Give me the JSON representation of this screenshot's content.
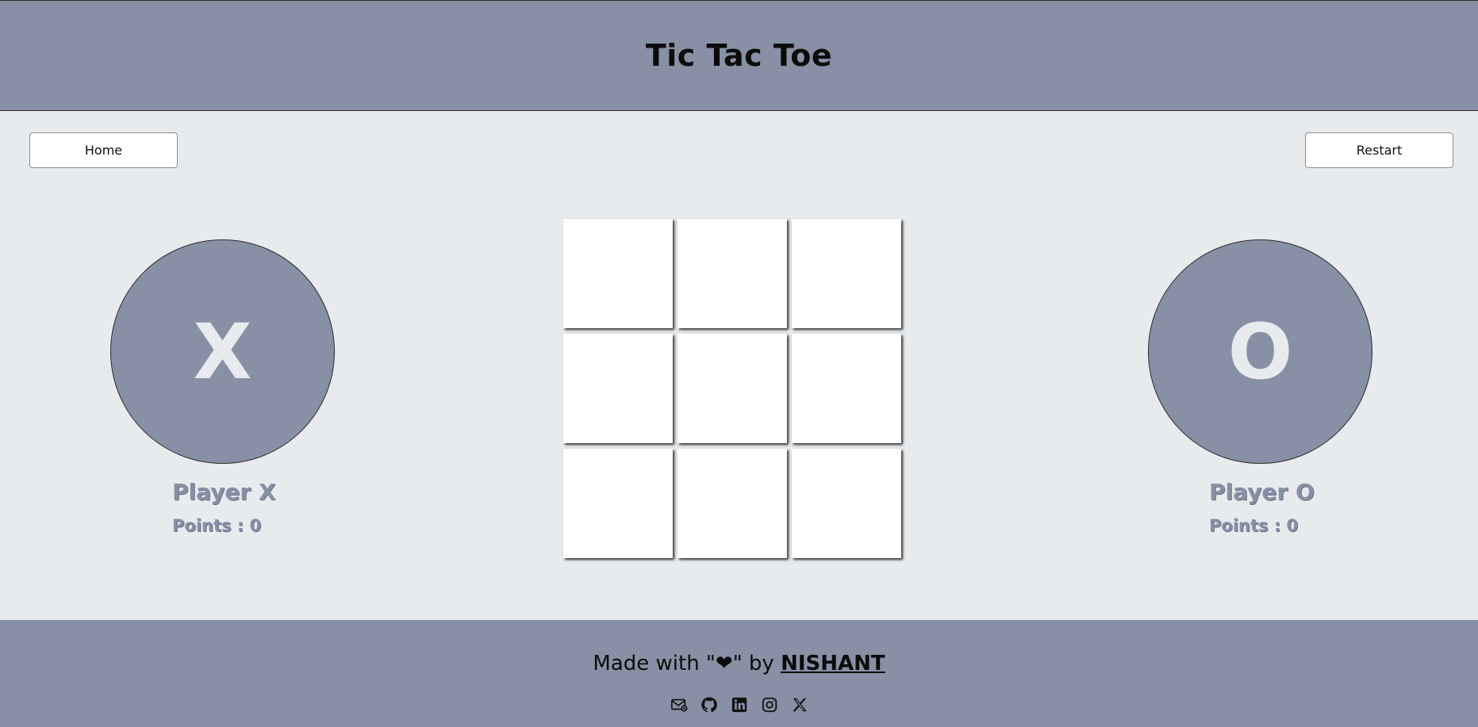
{
  "header": {
    "title": "Tic Tac Toe"
  },
  "buttons": {
    "home": "Home",
    "restart": "Restart"
  },
  "players": {
    "x": {
      "symbol": "X",
      "name": "Player X",
      "points": "Points : 0"
    },
    "o": {
      "symbol": "O",
      "name": "Player O",
      "points": "Points : 0"
    }
  },
  "board": {
    "cells": [
      "",
      "",
      "",
      "",
      "",
      "",
      "",
      "",
      ""
    ]
  },
  "footer": {
    "prefix": "Made with \"",
    "heart": "❤",
    "mid": "\" by ",
    "author": "NISHANT",
    "socials": [
      "mail-icon",
      "github-icon",
      "linkedin-icon",
      "instagram-icon",
      "x-icon"
    ]
  },
  "colors": {
    "accent": "#8790a5",
    "background": "#e8ebee",
    "cell": "#ffffff",
    "text": "#0b0b0b"
  }
}
